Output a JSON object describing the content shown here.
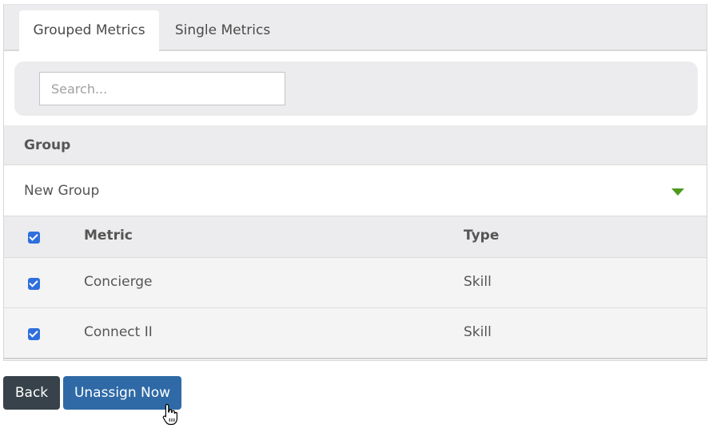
{
  "tabs": [
    {
      "label": "Grouped Metrics",
      "active": true
    },
    {
      "label": "Single Metrics",
      "active": false
    }
  ],
  "search": {
    "placeholder": "Search...",
    "value": ""
  },
  "group_section": {
    "header": "Group",
    "selected_group": "New Group"
  },
  "table": {
    "columns": [
      "Metric",
      "Type"
    ],
    "select_all_checked": true,
    "rows": [
      {
        "checked": true,
        "metric": "Concierge",
        "type": "Skill"
      },
      {
        "checked": true,
        "metric": "Connect II",
        "type": "Skill"
      }
    ]
  },
  "actions": {
    "back_label": "Back",
    "unassign_label": "Unassign Now"
  },
  "colors": {
    "checkbox_blue": "#2f6fdd",
    "caret_green": "#4e9a1e",
    "back_button": "#37424a",
    "unassign_button": "#2f6aa7"
  }
}
